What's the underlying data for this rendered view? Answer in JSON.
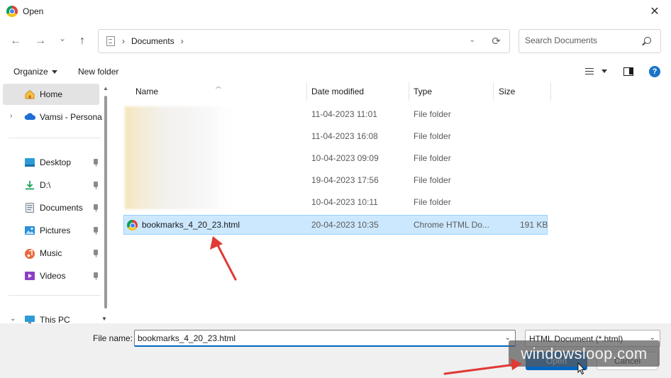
{
  "window": {
    "title": "Open",
    "close_glyph": "✕"
  },
  "nav": {
    "back_glyph": "←",
    "forward_glyph": "→",
    "recent_glyph": "⌄",
    "up_glyph": "↑",
    "breadcrumb": "Documents",
    "sep": "›",
    "dropdown_glyph": "⌄",
    "refresh_glyph": "⟳"
  },
  "search": {
    "placeholder": "Search Documents"
  },
  "toolbar": {
    "organize": "Organize",
    "new_folder": "New folder"
  },
  "help": {
    "glyph": "?"
  },
  "sidebar": {
    "home": "Home",
    "onedrive": "Vamsi - Persona",
    "desktop": "Desktop",
    "d_drive": "D:\\",
    "documents": "Documents",
    "pictures": "Pictures",
    "music": "Music",
    "videos": "Videos",
    "thispc": "This PC"
  },
  "columns": {
    "name": "Name",
    "date": "Date modified",
    "type": "Type",
    "size": "Size"
  },
  "rows": [
    {
      "name": "",
      "date": "11-04-2023 11:01",
      "type": "File folder",
      "size": ""
    },
    {
      "name": "",
      "date": "11-04-2023 16:08",
      "type": "File folder",
      "size": ""
    },
    {
      "name": "",
      "date": "10-04-2023 09:09",
      "type": "File folder",
      "size": ""
    },
    {
      "name": "",
      "date": "19-04-2023 17:56",
      "type": "File folder",
      "size": ""
    },
    {
      "name": "",
      "date": "10-04-2023 10:11",
      "type": "File folder",
      "size": ""
    },
    {
      "name": "bookmarks_4_20_23.html",
      "date": "20-04-2023 10:35",
      "type": "Chrome HTML Do...",
      "size": "191 KB"
    }
  ],
  "footer": {
    "file_name_label": "File name:",
    "file_name_value": "bookmarks_4_20_23.html",
    "file_type": "HTML Document (*.html)",
    "open": "Open",
    "cancel": "Cancel"
  },
  "watermark": "windowsloop.com",
  "colors": {
    "accent": "#0067c0",
    "selection": "#cce8ff",
    "annotation_arrow": "#e03a36"
  }
}
